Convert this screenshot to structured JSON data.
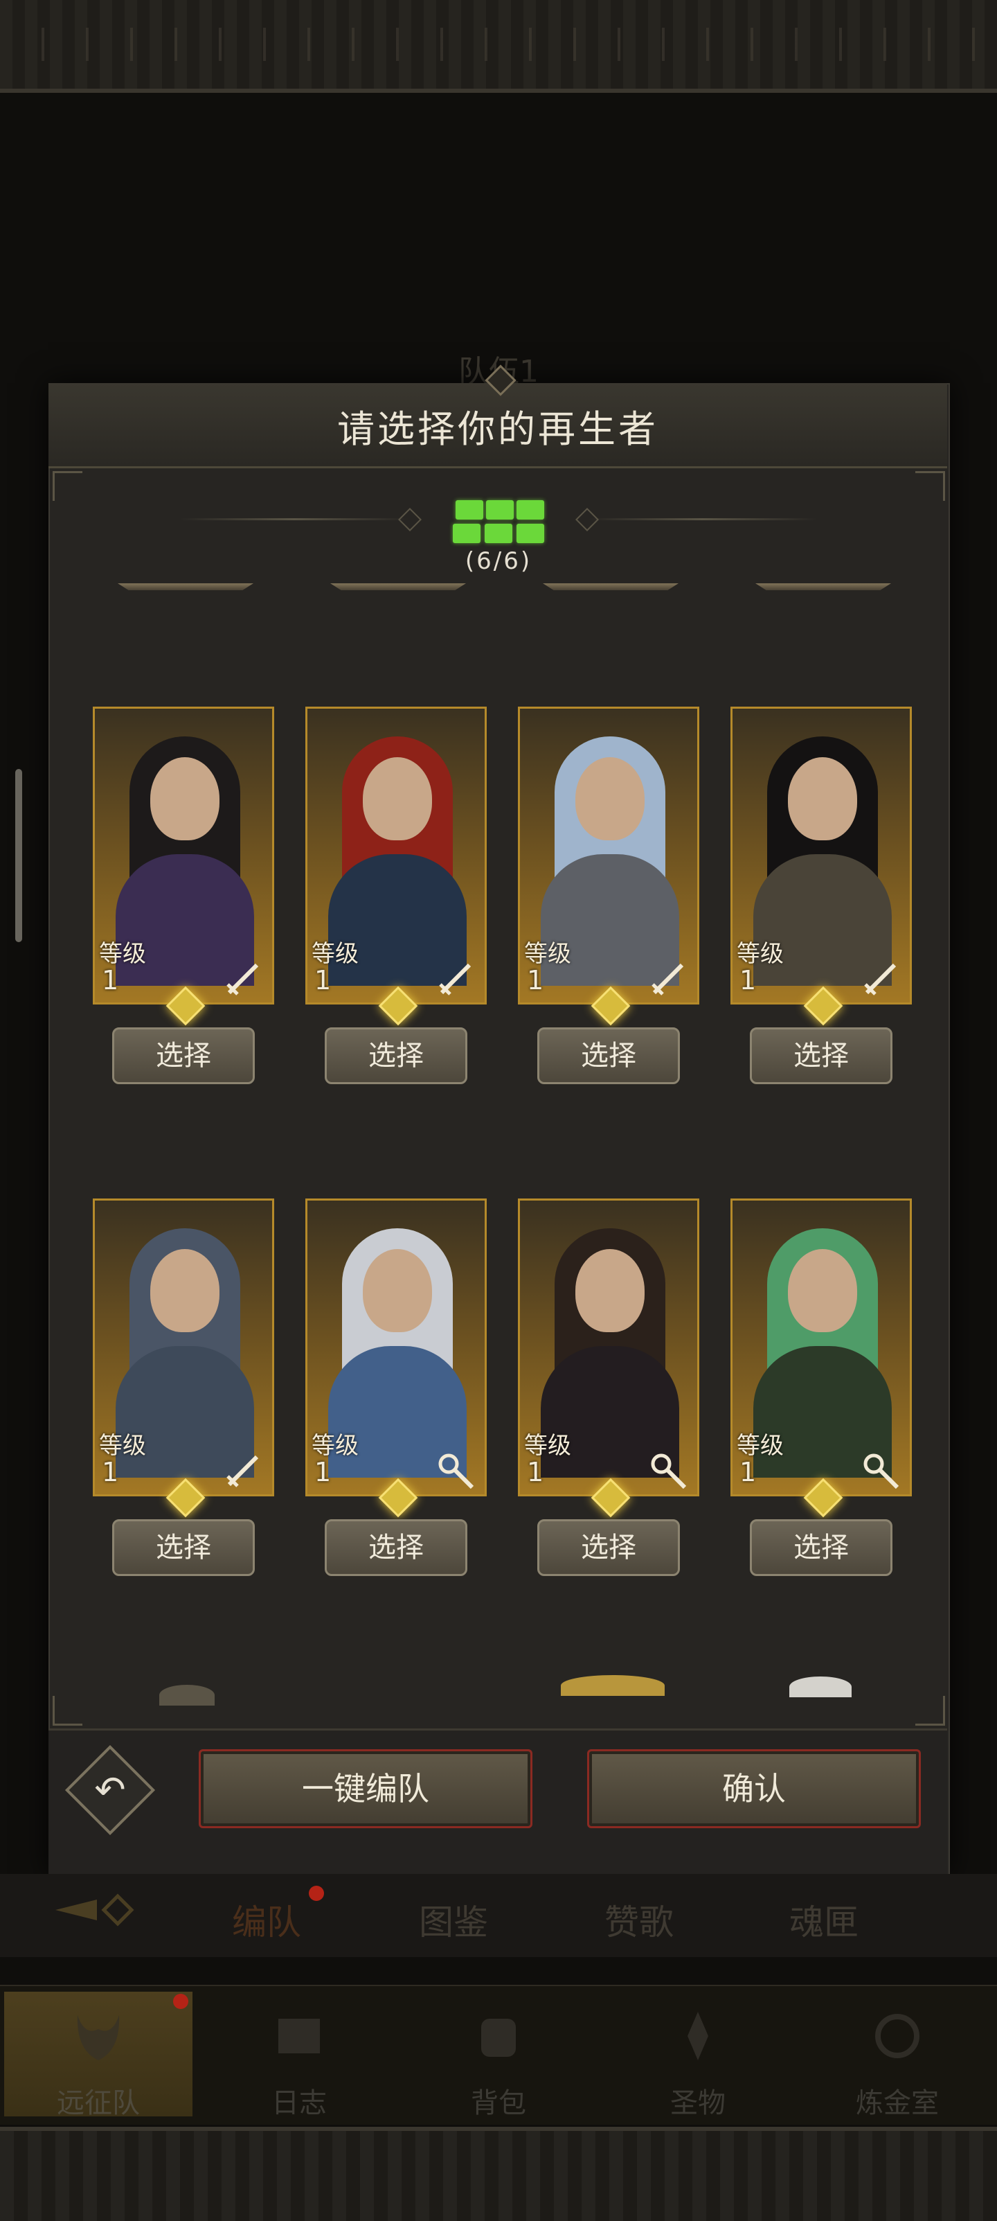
{
  "background": {
    "team_title": "队伍1"
  },
  "dialog": {
    "title": "请选择你的再生者",
    "team_count": "(6/6)",
    "level_label": "等级",
    "heroes": [
      {
        "level": "1",
        "weapon": "sword-icon",
        "button": "选择",
        "palette": {
          "hair": "#1d1a1a",
          "body": "#3b2d52"
        }
      },
      {
        "level": "1",
        "weapon": "sword-icon",
        "button": "选择",
        "palette": {
          "hair": "#8e2218",
          "body": "#243348"
        }
      },
      {
        "level": "1",
        "weapon": "sword-icon",
        "button": "选择",
        "palette": {
          "hair": "#9fb4cc",
          "body": "#5d6066"
        }
      },
      {
        "level": "1",
        "weapon": "sword-icon",
        "button": "选择",
        "palette": {
          "hair": "#141212",
          "body": "#4a4438"
        }
      },
      {
        "level": "1",
        "weapon": "sword-icon",
        "button": "选择",
        "palette": {
          "hair": "#4a5566",
          "body": "#3e4a5a"
        }
      },
      {
        "level": "1",
        "weapon": "staff-icon",
        "button": "选择",
        "palette": {
          "hair": "#c9ccd2",
          "body": "#42608a"
        }
      },
      {
        "level": "1",
        "weapon": "staff-icon",
        "button": "选择",
        "palette": {
          "hair": "#2b211b",
          "body": "#231d20"
        }
      },
      {
        "level": "1",
        "weapon": "staff-icon",
        "button": "选择",
        "palette": {
          "hair": "#4f9c68",
          "body": "#2c3a28"
        }
      }
    ],
    "auto_team_button": "一键编队",
    "confirm_button": "确认"
  },
  "tabs": [
    "编队",
    "图鉴",
    "赞歌",
    "魂匣"
  ],
  "nav": [
    "远征队",
    "日志",
    "背包",
    "圣物",
    "炼金室"
  ],
  "colors": {
    "accent_gold": "#b58a2a",
    "team_green": "#6bd83a",
    "badge_red": "#b52316"
  }
}
